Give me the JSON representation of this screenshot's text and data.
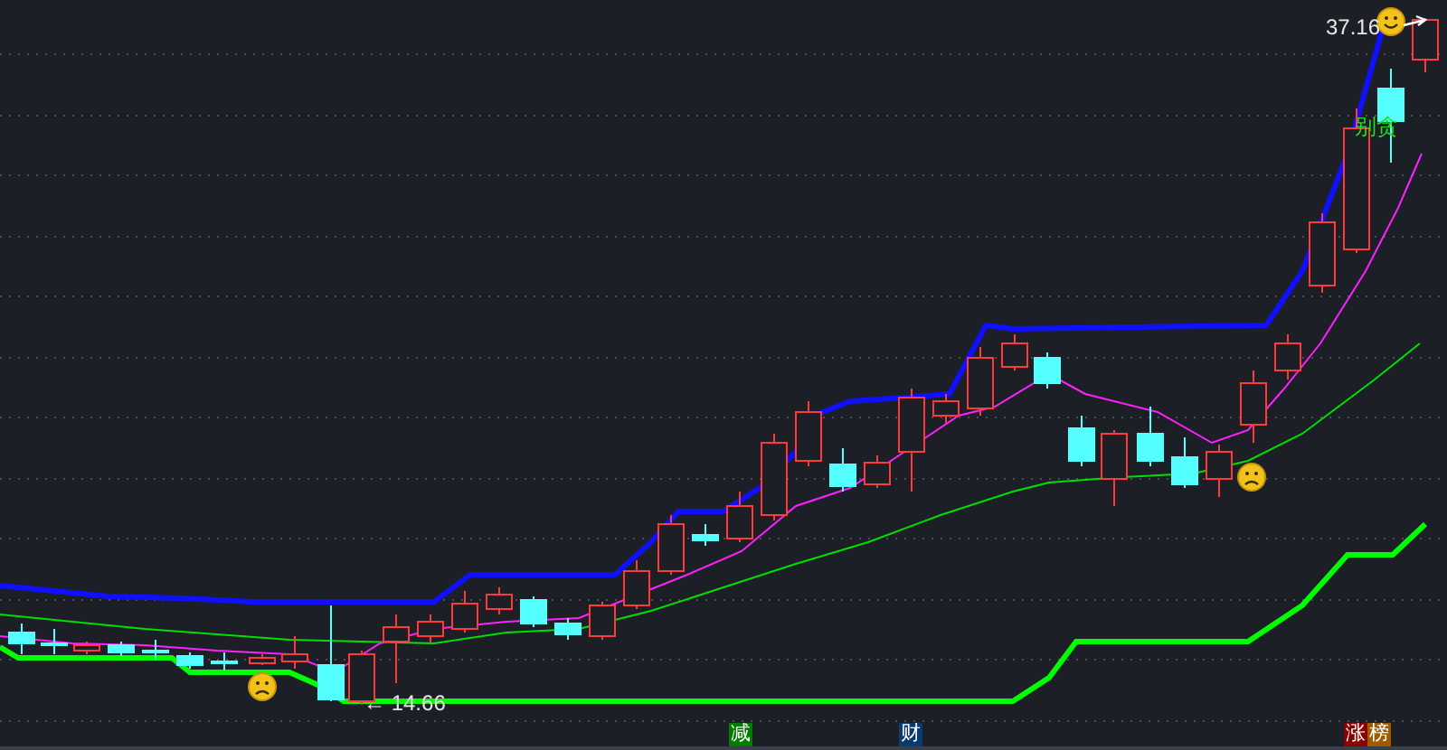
{
  "chart": {
    "high_label": "37.16",
    "low_label": "← 14.66",
    "annotation": "别贪"
  },
  "markers": [
    {
      "text": "减",
      "color": "#007a00"
    },
    {
      "text": "财",
      "color": "#0a3a6e"
    },
    {
      "text": "涨",
      "color": "#8a0000"
    },
    {
      "text": "榜",
      "color": "#a05a00"
    }
  ]
}
